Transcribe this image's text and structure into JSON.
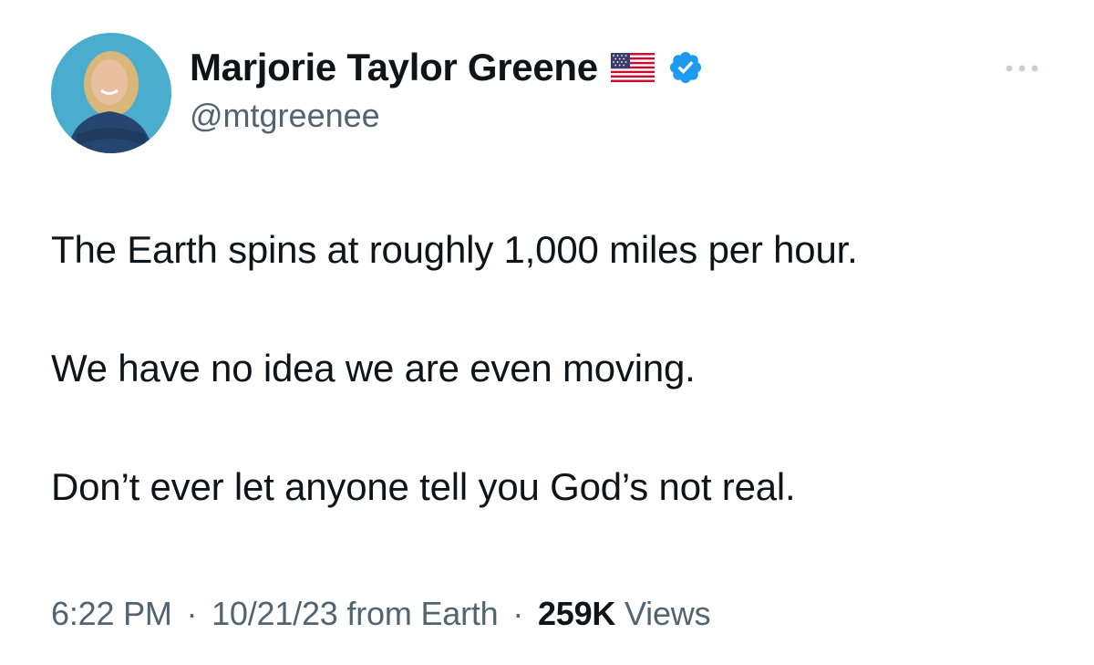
{
  "author": {
    "display_name": "Marjorie Taylor Greene",
    "handle": "@mtgreenee",
    "flag_icon": "us-flag-icon",
    "verified_icon": "verified-badge-icon",
    "verified_color": "#1d9bf0"
  },
  "tweet": {
    "paragraphs": [
      "The Earth spins at roughly 1,000 miles per hour.",
      "We have no idea we are even moving.",
      "Don’t ever let anyone tell you God’s not real."
    ]
  },
  "meta": {
    "time": "6:22 PM",
    "separator": "·",
    "date": "10/21/23",
    "source": "from Earth",
    "views_count": "259K",
    "views_label": "Views"
  },
  "colors": {
    "text_primary": "#0f1419",
    "text_secondary": "#536471",
    "background": "#ffffff"
  }
}
